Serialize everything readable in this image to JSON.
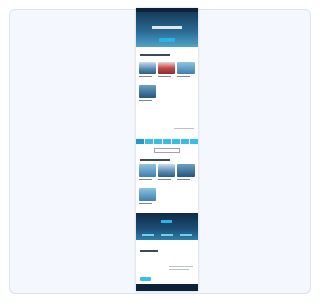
{
  "hero": {
    "title": "",
    "button_label": ""
  },
  "sections": [
    {
      "title": "",
      "cards": [
        {
          "caption": ""
        },
        {
          "caption": ""
        },
        {
          "caption": ""
        },
        {
          "caption": ""
        }
      ]
    },
    {
      "title": "",
      "cards": [
        {
          "caption": ""
        },
        {
          "caption": ""
        },
        {
          "caption": ""
        },
        {
          "caption": ""
        }
      ]
    }
  ],
  "tabs": [
    {
      "label": ""
    },
    {
      "label": ""
    },
    {
      "label": ""
    },
    {
      "label": ""
    },
    {
      "label": ""
    },
    {
      "label": ""
    },
    {
      "label": ""
    }
  ],
  "promo": {
    "title": ""
  },
  "banner": {
    "label": "",
    "buttons": [
      {
        "label": ""
      },
      {
        "label": ""
      },
      {
        "label": ""
      }
    ]
  },
  "contact": {
    "title": "",
    "button_label": ""
  },
  "footer": {
    "text": ""
  },
  "colors": {
    "accent": "#37bde9",
    "hero_dark": "#12324f",
    "footer": "#0d2236",
    "frame_background": "#f4f7fd"
  },
  "icons": [
    "hero-image",
    "yacht-photo",
    "sea-photo"
  ]
}
